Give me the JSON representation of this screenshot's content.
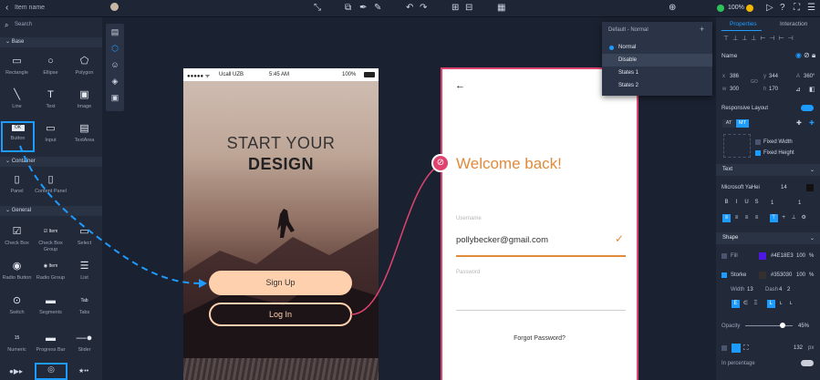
{
  "topbar": {
    "back_label": "Item name",
    "zoom": "100%"
  },
  "left_panel": {
    "search_placeholder": "Search",
    "sections": {
      "base": "Base",
      "container": "Container",
      "general": "General"
    },
    "base_items": [
      "Rectangle",
      "Ellipse",
      "Polygon",
      "Line",
      "Text",
      "Image",
      "Button",
      "Input",
      "TextArea"
    ],
    "container_items": [
      "Panel",
      "Content Panel"
    ],
    "general_items": [
      "Check Box",
      "Check Box Group",
      "Select",
      "Radio Button",
      "Radio Group",
      "List",
      "Switch",
      "Segments",
      "Tabs",
      "Numeric",
      "Progress Bar",
      "Slider"
    ],
    "button_chip": "OK",
    "stepper_chip": "15",
    "tab_chip": "Tab",
    "checkbox_group_chip": "Item",
    "radio_group_chip": "Item"
  },
  "phone1": {
    "carrier": "Ucall UZB",
    "time": "5:45 AM",
    "battery": "100%",
    "headline_1": "START YOUR",
    "headline_2": "DESIGN",
    "signup": "Sign Up",
    "login": "Log In"
  },
  "phone2": {
    "back_arrow": "←",
    "welcome": "Welcome back!",
    "username_label": "Username",
    "username_value": "pollybecker@gmail.com",
    "password_label": "Password",
    "forgot": "Forgot Password?"
  },
  "dropdown": {
    "title": "Default - Normal",
    "add": "+",
    "options": [
      "Normal",
      "Disable",
      "States 1",
      "States 2"
    ]
  },
  "right_panel": {
    "tabs": [
      "Properties",
      "Interaction"
    ],
    "name_label": "Name",
    "x": "386",
    "y": "344",
    "angle": "360°",
    "w": "300",
    "h": "170",
    "labels": {
      "x": "x",
      "y": "y",
      "w": "w",
      "h": "h",
      "a": "A",
      "go": "GO"
    },
    "responsive": "Responsive Layout",
    "at": "AT",
    "mt": "MT",
    "fixed_width": "Fixed Width",
    "fixed_height": "Fixed Height",
    "text_header": "Text",
    "font": "Microsoft YaHei",
    "font_size": "14",
    "style_buttons": [
      "B",
      "I",
      "U",
      "S"
    ],
    "letter_spacing": "1",
    "line_spacing": "1",
    "shape_header": "Shape",
    "fill_label": "Fill",
    "fill_hex": "#4E18E3",
    "fill_pct": "100",
    "stroke_label": "Storke",
    "stroke_hex": "#353030",
    "stroke_pct": "100",
    "width_label": "Width",
    "width_val": "13",
    "dash_label": "Dash",
    "dash_a": "4",
    "dash_b": "2",
    "opacity_label": "Opacity",
    "opacity_val": "45%",
    "radius_val": "132",
    "radius_unit": "px",
    "in_percentage": "In percentage",
    "percent_sign": "%"
  },
  "colors": {
    "accent": "#1e9bff",
    "pink": "#e0436f",
    "peach": "#ffd0ad",
    "orange": "#e08a3c",
    "fill": "#4E18E3"
  }
}
